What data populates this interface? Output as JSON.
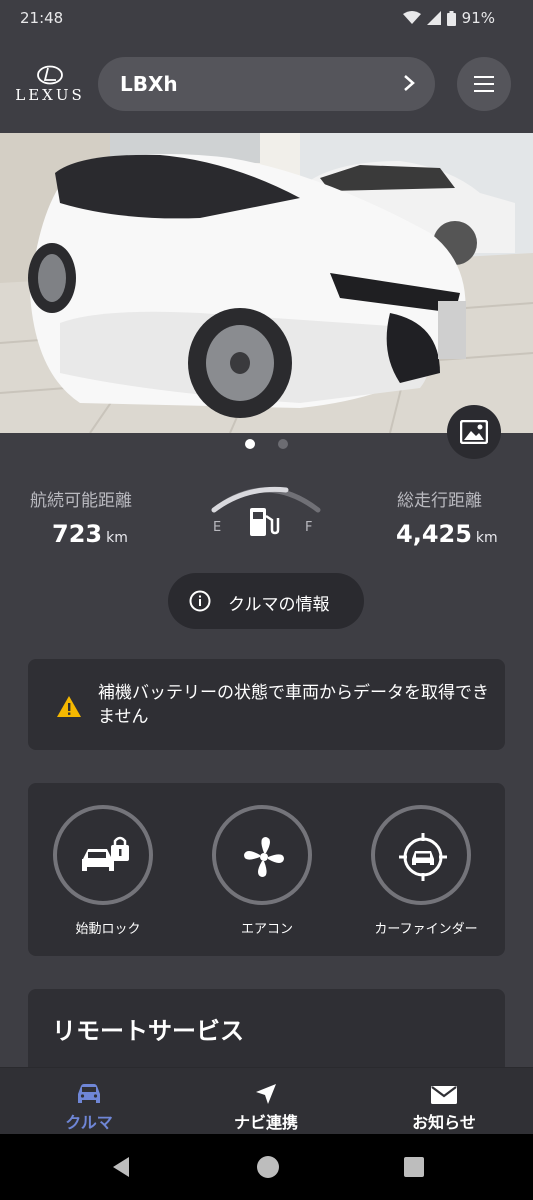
{
  "status_bar": {
    "time": "21:48",
    "battery": "91%"
  },
  "header": {
    "logo": "LEXUS",
    "vehicle_name": "LBXh"
  },
  "stats": {
    "range_label": "航続可能距離",
    "range_value": "723",
    "range_unit": "km",
    "fuel_empty_label": "E",
    "fuel_full_label": "F",
    "odometer_label": "総走行距離",
    "odometer_value": "4,425",
    "odometer_unit": "km"
  },
  "info_button": {
    "label": "クルマの情報"
  },
  "alert": {
    "message": "補機バッテリーの状態で車両からデータを取得できません"
  },
  "quick_actions": [
    {
      "label": "始動ロック",
      "icon": "car-lock-icon"
    },
    {
      "label": "エアコン",
      "icon": "fan-icon"
    },
    {
      "label": "カーファインダー",
      "icon": "car-finder-icon"
    }
  ],
  "remote_services": {
    "title": "リモートサービス"
  },
  "bottom_nav": [
    {
      "label": "クルマ",
      "icon": "car-icon",
      "active": true
    },
    {
      "label": "ナビ連携",
      "icon": "navigation-arrow-icon",
      "active": false
    },
    {
      "label": "お知らせ",
      "icon": "mail-icon",
      "active": false
    }
  ],
  "colors": {
    "background": "#3e3e44",
    "card": "#2f2f34",
    "accent_active": "#6f86d6",
    "warning": "#f5b800"
  }
}
